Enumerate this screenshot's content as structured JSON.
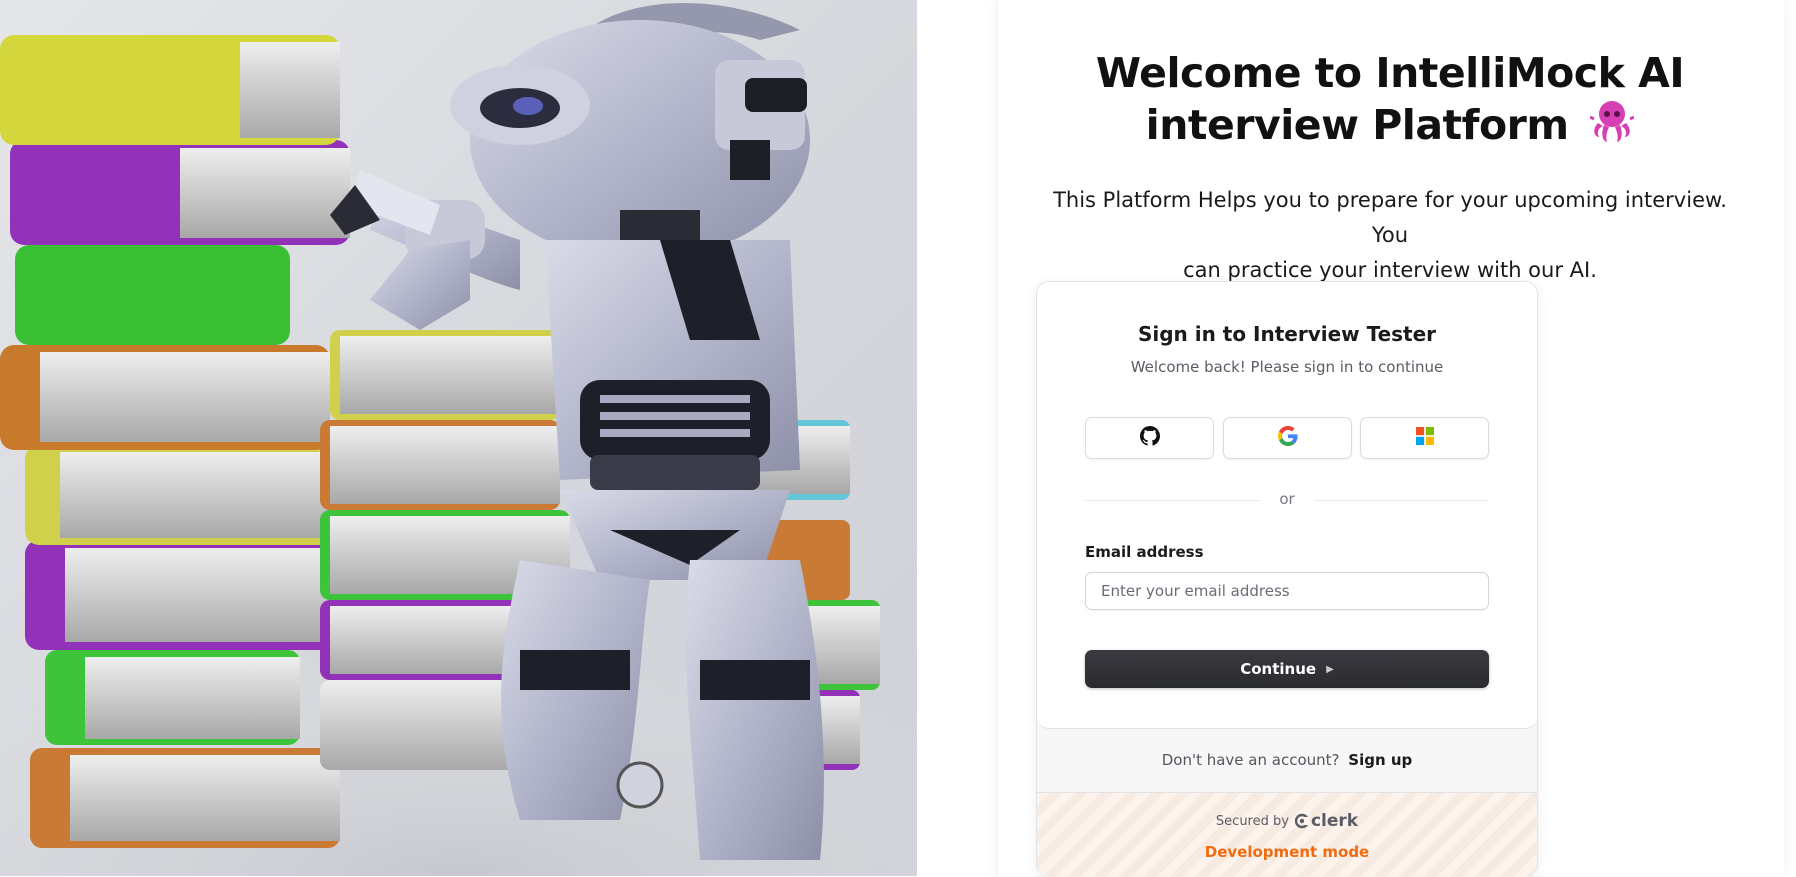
{
  "hero": {
    "image": "robot-with-books-illustration"
  },
  "welcome": {
    "title_line1": "Welcome to IntelliMock AI",
    "title_line2": "interview Platform",
    "title_icon": "octopus-emoji",
    "subtitle_line1": "This Platform Helps you to prepare for your upcoming interview. You",
    "subtitle_line2": "can practice your interview with our AI."
  },
  "signin": {
    "title": "Sign in to Interview Tester",
    "subtitle": "Welcome back! Please sign in to continue",
    "social_buttons": [
      {
        "provider": "github",
        "icon": "github-icon"
      },
      {
        "provider": "google",
        "icon": "google-icon"
      },
      {
        "provider": "microsoft",
        "icon": "microsoft-icon"
      }
    ],
    "divider_text": "or",
    "email_label": "Email address",
    "email_placeholder": "Enter your email address",
    "email_value": "",
    "continue_label": "Continue",
    "no_account_text": "Don't have an account?",
    "signup_label": "Sign up",
    "secured_by": "Secured by",
    "brand": "clerk",
    "dev_mode": "Development mode"
  },
  "colors": {
    "primary_button": "#2f3035",
    "dev_mode": "#f26b10",
    "octopus": "#d63fb3"
  }
}
